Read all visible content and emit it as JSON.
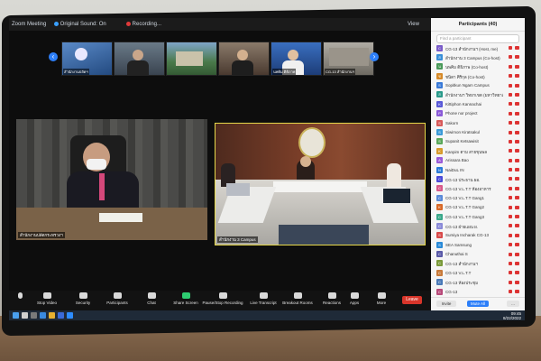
{
  "window": {
    "title": "Zoom Meeting"
  },
  "topbar": {
    "original_sound": "Original Sound: On",
    "recording": "Recording...",
    "view": "View"
  },
  "thumbnails": [
    {
      "name": "สำนักงานปลัดฯ",
      "color": "#3a6fb0"
    },
    {
      "name": "",
      "color": "#5a6a7a"
    },
    {
      "name": "",
      "color": "#4f7d4a"
    },
    {
      "name": "",
      "color": "#7a6a5a"
    },
    {
      "name": "นพคิม ติธิภาพ",
      "color": "#2f5fa5"
    },
    {
      "name": "CG-13 สำนักงานฯ",
      "color": "#8a8a82"
    }
  ],
  "videos": {
    "left_name": "สำนักงานปลัดกระทรวงฯ",
    "right_name": "สำนักงาน 3 Campus"
  },
  "toolbar": {
    "items": [
      "Stop Video",
      "Security",
      "Participants",
      "Chat",
      "Share Screen",
      "Pause/Stop Recording",
      "Live Transcript",
      "Breakout Rooms",
      "Reactions",
      "Apps",
      "More"
    ],
    "leave": "Leave"
  },
  "participants": {
    "title": "Participants (40)",
    "search_placeholder": "Find a participant",
    "items": [
      {
        "name": "CG-13 สำนักงานฯ (Host, me)",
        "color": "#7a5cc9",
        "initial": "C"
      },
      {
        "name": "สำนักงาน 3 Campus (Co-host)",
        "color": "#3a8fd8",
        "initial": "ส"
      },
      {
        "name": "นพคิม ติธิภาพ (Co-host)",
        "color": "#4a9a5a",
        "initial": "น"
      },
      {
        "name": "ชนิดา ศิริกุล (Co-host)",
        "color": "#d68a2a",
        "initial": "ช"
      },
      {
        "name": "Sopitkun Ngam Campus",
        "color": "#3a7ad8",
        "initial": "S"
      },
      {
        "name": "สำนักงานฯ วิทยาเขต (มหาวิทยาลัย)",
        "color": "#2a9a8a",
        "initial": "ส"
      },
      {
        "name": "Kittiphon Kannachai",
        "color": "#5a5ad8",
        "initial": "K"
      },
      {
        "name": "Phone nor project",
        "color": "#8a5ad8",
        "initial": "P"
      },
      {
        "name": "Sakorn",
        "color": "#d85a5a",
        "initial": "S"
      },
      {
        "name": "Siwimon Kiratsakul",
        "color": "#3a9ad8",
        "initial": "S"
      },
      {
        "name": "Supanit Ketsawisit",
        "color": "#5aa85a",
        "initial": "S"
      },
      {
        "name": "Kanpim ตาม สายขุนพล",
        "color": "#d89a2a",
        "initial": "K"
      },
      {
        "name": "Arissara Bao",
        "color": "#9a5ad8",
        "initial": "A"
      },
      {
        "name": "NaiDuL IN",
        "color": "#2a7ad8",
        "initial": "N"
      },
      {
        "name": "CG-13 ประธาน ผอ.",
        "color": "#4a4ad8",
        "initial": "C"
      },
      {
        "name": "CG-13 V.L.T.T ห้องอาหาร",
        "color": "#d85a8a",
        "initial": "C"
      },
      {
        "name": "CG-13 V.L.T.T Gang1",
        "color": "#5a8ad8",
        "initial": "C"
      },
      {
        "name": "CG-13 V.L.T.T Gang2",
        "color": "#d86a2a",
        "initial": "K"
      },
      {
        "name": "CG-13 V.L.T.T Gang3",
        "color": "#3aa88a",
        "initial": "C"
      },
      {
        "name": "CG-13 ฝ่ายแผน ผ.",
        "color": "#8a8ad8",
        "initial": "C"
      },
      {
        "name": "Sumiya Incharak CG-13",
        "color": "#d84a4a",
        "initial": "S"
      },
      {
        "name": "SEA Samsung",
        "color": "#2a8ad8",
        "initial": "S"
      },
      {
        "name": "Chanuthai S",
        "color": "#5a5aa8",
        "initial": "C"
      },
      {
        "name": "CG-13 สำนักงานฯ",
        "color": "#7a9a3a",
        "initial": "C"
      },
      {
        "name": "CG-13 V.L.T.T",
        "color": "#c87a3a",
        "initial": "C"
      },
      {
        "name": "CG-13 ห้องประชุม",
        "color": "#4a7ab8",
        "initial": "C"
      },
      {
        "name": "CG-13",
        "color": "#b84a7a",
        "initial": "C"
      }
    ],
    "invite": "Invite",
    "mute_all": "Mute All",
    "more": "..."
  },
  "taskbar": {
    "time": "09:45",
    "date": "8/22/2022"
  }
}
